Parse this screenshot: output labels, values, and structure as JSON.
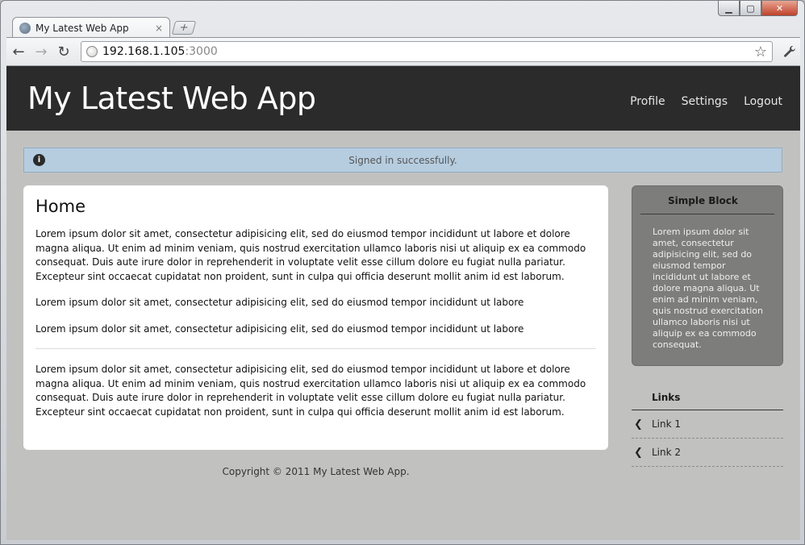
{
  "browser": {
    "tab_title": "My Latest Web App",
    "tab_close": "×",
    "new_tab": "+",
    "url_host": "192.168.1.105",
    "url_port": ":3000",
    "window_controls": {
      "minimize": "▁",
      "maximize": "▢",
      "close": "✕"
    },
    "nav": {
      "back": "←",
      "forward": "→",
      "reload": "↻",
      "star": "☆",
      "wrench": "🔧"
    }
  },
  "site": {
    "title": "My Latest Web App",
    "nav": [
      "Profile",
      "Settings",
      "Logout"
    ]
  },
  "flash": {
    "icon": "i",
    "message": "Signed in successfully."
  },
  "main": {
    "heading": "Home",
    "paragraphs": [
      "Lorem ipsum dolor sit amet, consectetur adipisicing elit, sed do eiusmod tempor incididunt ut labore et dolore magna aliqua. Ut enim ad minim veniam, quis nostrud exercitation ullamco laboris nisi ut aliquip ex ea commodo consequat. Duis aute irure dolor in reprehenderit in voluptate velit esse cillum dolore eu fugiat nulla pariatur. Excepteur sint occaecat cupidatat non proident, sunt in culpa qui officia deserunt mollit anim id est laborum.",
      "Lorem ipsum dolor sit amet, consectetur adipisicing elit, sed do eiusmod tempor incididunt ut labore",
      "Lorem ipsum dolor sit amet, consectetur adipisicing elit, sed do eiusmod tempor incididunt ut labore",
      "Lorem ipsum dolor sit amet, consectetur adipisicing elit, sed do eiusmod tempor incididunt ut labore et dolore magna aliqua. Ut enim ad minim veniam, quis nostrud exercitation ullamco laboris nisi ut aliquip ex ea commodo consequat. Duis aute irure dolor in reprehenderit in voluptate velit esse cillum dolore eu fugiat nulla pariatur. Excepteur sint occaecat cupidatat non proident, sunt in culpa qui officia deserunt mollit anim id est laborum."
    ]
  },
  "footer": "Copyright © 2011 My Latest Web App.",
  "sidebar": {
    "simple_block": {
      "title": "Simple Block",
      "text": "Lorem ipsum dolor sit amet, consectetur adipisicing elit, sed do eiusmod tempor incididunt ut labore et dolore magna aliqua. Ut enim ad minim veniam, quis nostrud exercitation ullamco laboris nisi ut aliquip ex ea commodo consequat."
    },
    "links": {
      "title": "Links",
      "chevron": "❮",
      "items": [
        "Link 1",
        "Link 2"
      ]
    }
  },
  "colors": {
    "header_bg": "#2b2b2b",
    "flash_bg": "#b6cde0",
    "page_bg": "#c1c2c0",
    "sidebar_block_bg": "#7d7e7b"
  }
}
